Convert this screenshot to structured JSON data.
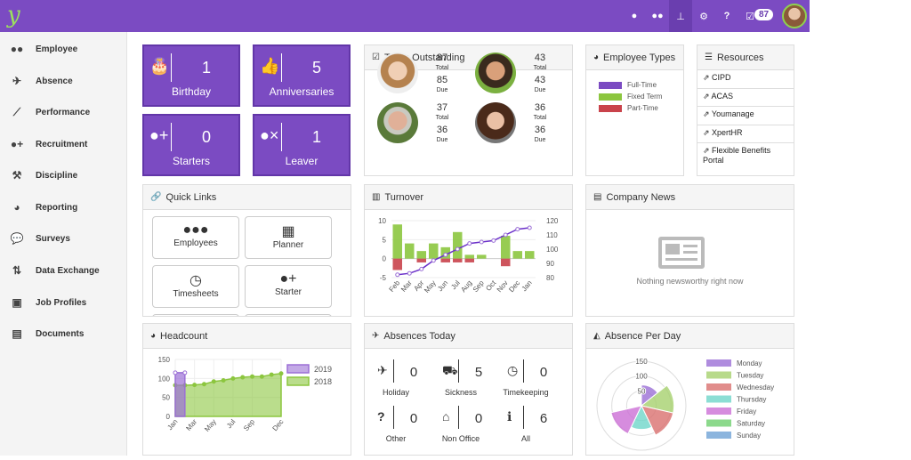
{
  "topbar": {
    "logo": "y",
    "icons": [
      "user-icon",
      "users-icon",
      "org-chart-icon",
      "gear-icon",
      "help-icon",
      "tasks-icon"
    ],
    "task_count": "87"
  },
  "sidebar": {
    "items": [
      {
        "label": "Employee",
        "icon": "users-icon"
      },
      {
        "label": "Absence",
        "icon": "plane-icon"
      },
      {
        "label": "Performance",
        "icon": "line-chart-icon"
      },
      {
        "label": "Recruitment",
        "icon": "user-plus-icon"
      },
      {
        "label": "Discipline",
        "icon": "gavel-icon"
      },
      {
        "label": "Reporting",
        "icon": "pie-chart-icon"
      },
      {
        "label": "Surveys",
        "icon": "comment-icon"
      },
      {
        "label": "Data Exchange",
        "icon": "exchange-icon"
      },
      {
        "label": "Job Profiles",
        "icon": "briefcase-icon"
      },
      {
        "label": "Documents",
        "icon": "book-icon"
      }
    ]
  },
  "tiles": [
    {
      "value": "1",
      "label": "Birthday",
      "icon": "cake-icon"
    },
    {
      "value": "5",
      "label": "Anniversaries",
      "icon": "thumbs-up-icon"
    },
    {
      "value": "0",
      "label": "Starters",
      "icon": "user-plus-icon"
    },
    {
      "value": "1",
      "label": "Leaver",
      "icon": "user-times-icon"
    }
  ],
  "tasks": {
    "title": "Tasks Outstanding",
    "total_label": "Total",
    "due_label": "Due",
    "people": [
      {
        "total": "87",
        "due": "85"
      },
      {
        "total": "43",
        "due": "43"
      },
      {
        "total": "37",
        "due": "36"
      },
      {
        "total": "36",
        "due": "36"
      }
    ]
  },
  "employee_types": {
    "title": "Employee Types",
    "items": [
      {
        "label": "Full-Time",
        "color": "#7b4bc2"
      },
      {
        "label": "Fixed Term",
        "color": "#8cc63f"
      },
      {
        "label": "Part-Time",
        "color": "#c9434b"
      }
    ]
  },
  "resources": {
    "title": "Resources",
    "links": [
      "CIPD",
      "ACAS",
      "Youmanage",
      "XpertHR",
      "Flexible Benefits Portal"
    ]
  },
  "quick_links": {
    "title": "Quick Links",
    "items": [
      {
        "label": "Employees",
        "icon": "users-icon"
      },
      {
        "label": "Planner",
        "icon": "calendar-icon"
      },
      {
        "label": "Timesheets",
        "icon": "clock-icon"
      },
      {
        "label": "Starter",
        "icon": "user-plus-icon"
      }
    ]
  },
  "company_news": {
    "title": "Company News",
    "empty": "Nothing newsworthy right now"
  },
  "absences_today": {
    "title": "Absences Today",
    "items": [
      {
        "label": "Holiday",
        "value": "0",
        "icon": "plane-icon"
      },
      {
        "label": "Sickness",
        "value": "5",
        "icon": "ambulance-icon"
      },
      {
        "label": "Timekeeping",
        "value": "0",
        "icon": "clock-icon"
      },
      {
        "label": "Other",
        "value": "0",
        "icon": "question-icon"
      },
      {
        "label": "Non Office",
        "value": "0",
        "icon": "home-icon"
      },
      {
        "label": "All",
        "value": "6",
        "icon": "info-icon"
      }
    ]
  },
  "chart_data": [
    {
      "type": "bar",
      "title": "Turnover",
      "categories": [
        "Feb",
        "Mar",
        "Apr",
        "May",
        "Jun",
        "Jul",
        "Aug",
        "Sep",
        "Oct",
        "Nov",
        "Dec",
        "Jan"
      ],
      "series": [
        {
          "values": [
            9,
            4,
            2,
            4,
            3,
            7,
            1,
            1,
            0,
            6,
            2,
            2
          ],
          "color": "#8cc63f"
        },
        {
          "values": [
            -3,
            0,
            -1,
            0,
            -1,
            -1,
            -1,
            0,
            0,
            -2,
            0,
            0
          ],
          "color": "#c9434b"
        },
        {
          "type": "line",
          "axis": "right",
          "values": [
            82,
            83,
            86,
            92,
            96,
            100,
            104,
            105,
            106,
            110,
            114,
            115
          ],
          "color": "#6a2fc9"
        }
      ],
      "ylim": [
        -5,
        10
      ],
      "yticks": [
        -5,
        0,
        5,
        10
      ],
      "y2lim": [
        80,
        120
      ],
      "y2ticks": [
        80,
        90,
        100,
        110,
        120
      ],
      "grid": true
    },
    {
      "type": "area",
      "title": "Headcount",
      "x": [
        "Jan",
        "Feb",
        "Mar",
        "Apr",
        "May",
        "Jun",
        "Jul",
        "Aug",
        "Sep",
        "Oct",
        "Nov",
        "Dec"
      ],
      "xticks": [
        "Jan",
        "Mar",
        "May",
        "Jul",
        "Sep",
        "Dec"
      ],
      "series": [
        {
          "name": "2019",
          "values": [
            115,
            115
          ],
          "color": "#9b6fd6"
        },
        {
          "name": "2018",
          "values": [
            82,
            82,
            83,
            85,
            92,
            95,
            100,
            103,
            105,
            105,
            110,
            113
          ],
          "color": "#8cc63f"
        }
      ],
      "ylim": [
        0,
        150
      ],
      "yticks": [
        0,
        50,
        100,
        150
      ],
      "legend": "right",
      "grid": true
    },
    {
      "type": "polar",
      "title": "Absence Per Day",
      "categories": [
        "Monday",
        "Tuesday",
        "Wednesday",
        "Thursday",
        "Friday",
        "Saturday",
        "Sunday"
      ],
      "values": [
        70,
        110,
        110,
        80,
        105,
        0,
        0
      ],
      "colors": [
        "#9b6fd6",
        "#a6d16e",
        "#d9706f",
        "#6fd6c9",
        "#cc6fd6",
        "#6fcf6f",
        "#6fa3d6"
      ],
      "rlim": [
        0,
        150
      ],
      "rticks": [
        50,
        100,
        150
      ],
      "legend": "right"
    }
  ]
}
